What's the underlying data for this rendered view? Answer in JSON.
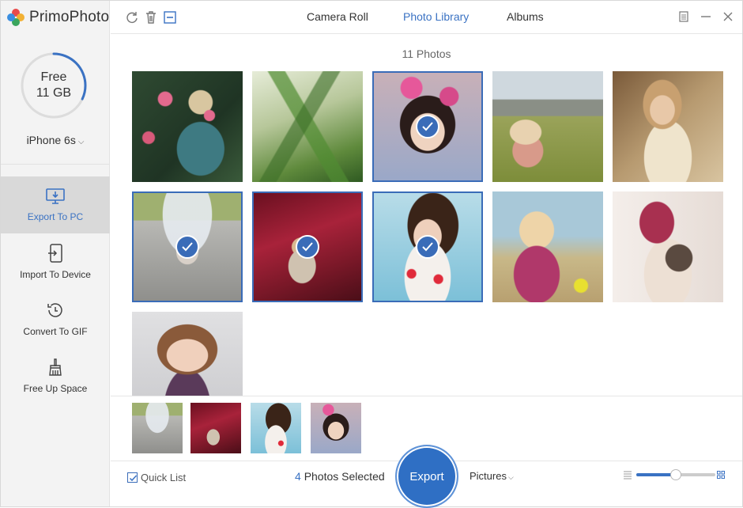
{
  "app": {
    "name": "PrimoPhoto"
  },
  "sidebar": {
    "storage": {
      "line1": "Free",
      "line2": "11 GB",
      "used_fraction": 0.32
    },
    "device": "iPhone 6s",
    "items": [
      {
        "label": "Export To PC",
        "icon": "monitor-export-icon",
        "active": true
      },
      {
        "label": "Import To Device",
        "icon": "phone-import-icon",
        "active": false
      },
      {
        "label": "Convert To GIF",
        "icon": "history-clock-icon",
        "active": false
      },
      {
        "label": "Free Up Space",
        "icon": "broom-icon",
        "active": false
      }
    ]
  },
  "toolbar": {
    "icons": [
      "refresh-icon",
      "trash-icon",
      "deselect-icon"
    ]
  },
  "tabs": [
    {
      "label": "Camera Roll",
      "active": false
    },
    {
      "label": "Photo Library",
      "active": true
    },
    {
      "label": "Albums",
      "active": false
    }
  ],
  "window_controls": [
    "menu-icon",
    "minimize-icon",
    "close-icon"
  ],
  "content": {
    "photo_count": "11 Photos",
    "photos": [
      {
        "subject": "girl in garden with roses",
        "selected": false
      },
      {
        "subject": "green plant leaves",
        "selected": false
      },
      {
        "subject": "girl with flower crown",
        "selected": true
      },
      {
        "subject": "girl sitting on grass",
        "selected": false
      },
      {
        "subject": "girl praying in white dress",
        "selected": false
      },
      {
        "subject": "girl with umbrella on road",
        "selected": true
      },
      {
        "subject": "girl by red flowers",
        "selected": true
      },
      {
        "subject": "curly-haired girl with bubbles",
        "selected": true
      },
      {
        "subject": "girl blowing bubbles",
        "selected": false
      },
      {
        "subject": "girl holding rabbit",
        "selected": false
      },
      {
        "subject": "smiling girl portrait",
        "selected": false
      }
    ]
  },
  "quick_list": {
    "label": "Quick List",
    "checked": true
  },
  "selection": {
    "count": "4",
    "label": "Photos Selected"
  },
  "export_button": "Export",
  "format": "Pictures",
  "zoom": {
    "fraction": 0.5
  },
  "colors": {
    "accent": "#3a72c3",
    "selection": "#3a6cb8",
    "export": "#2f6fc4"
  }
}
